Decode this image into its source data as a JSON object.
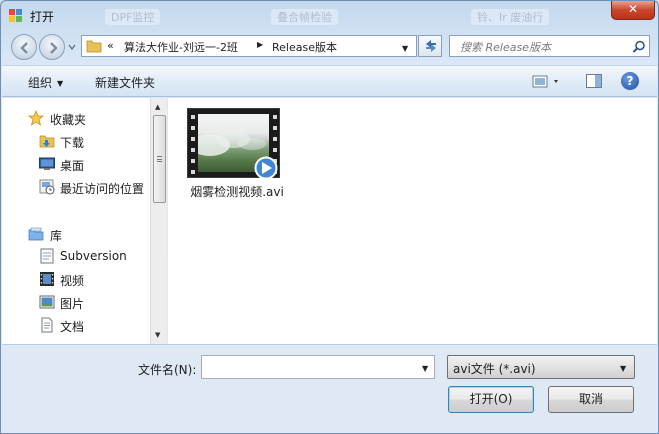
{
  "window": {
    "title": "打开",
    "close_label": "✕",
    "background_tabs": [
      "DPF监控",
      "叠合帧检验",
      "铃、Ir 废油行"
    ]
  },
  "address": {
    "chevron": "«",
    "crumbs": [
      "算法大作业-刘远一-2班",
      "Release版本"
    ]
  },
  "search": {
    "placeholder": "搜索 Release版本"
  },
  "toolbar": {
    "organize_label": "组织",
    "new_folder_label": "新建文件夹",
    "help_label": "?"
  },
  "sidebar": {
    "favorites": {
      "label": "收藏夹",
      "items": [
        {
          "label": "下载",
          "icon": "download-folder-icon"
        },
        {
          "label": "桌面",
          "icon": "desktop-icon"
        },
        {
          "label": "最近访问的位置",
          "icon": "recent-places-icon"
        }
      ]
    },
    "libraries": {
      "label": "库",
      "items": [
        {
          "label": "Subversion",
          "icon": "subversion-library-icon"
        },
        {
          "label": "视频",
          "icon": "video-library-icon"
        },
        {
          "label": "图片",
          "icon": "picture-library-icon"
        },
        {
          "label": "文档",
          "icon": "document-library-icon"
        }
      ]
    }
  },
  "files": [
    {
      "name": "烟雾检测视频.avi",
      "type": "video"
    }
  ],
  "bottom": {
    "filename_label": "文件名(N):",
    "filename_value": "",
    "filetype_value": "avi文件 (*.avi)",
    "open_label": "打开(O)",
    "cancel_label": "取消"
  },
  "colors": {
    "accent": "#3c7fb1",
    "close_red": "#c9452d",
    "chrome": "#dfe9f5"
  }
}
